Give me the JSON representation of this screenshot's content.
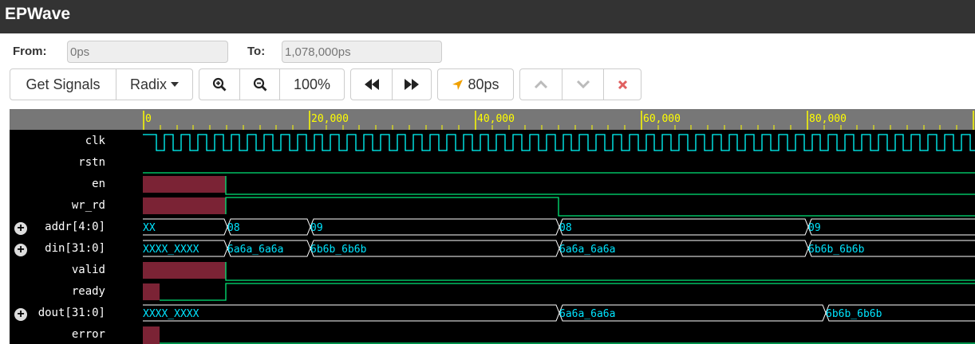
{
  "app": {
    "title": "EPWave"
  },
  "range": {
    "from_label": "From:",
    "from_value": "0ps",
    "to_label": "To:",
    "to_value": "1,078,000ps"
  },
  "toolbar": {
    "get_signals": "Get Signals",
    "radix": "Radix",
    "zoom": "100%",
    "cursor_time": "80ps"
  },
  "icons": {
    "zoom_in": "zoom-in-icon",
    "zoom_out": "zoom-out-icon",
    "prev": "rewind-icon",
    "next": "fast-forward-icon",
    "cursor": "location-arrow-icon",
    "up": "chevron-up-icon",
    "down": "chevron-down-icon",
    "close": "close-icon"
  },
  "colors": {
    "clock": "#00ffff",
    "level": "#00e676",
    "undefined": "#7b2335",
    "bus_text": "#00e5ff",
    "ruler_tick": "#ffff00"
  },
  "timeline": {
    "ticks": [
      "0",
      "20,000",
      "40,000",
      "60,000",
      "80,000"
    ]
  },
  "signals": [
    {
      "name": "clk",
      "expandable": false
    },
    {
      "name": "rstn",
      "expandable": false
    },
    {
      "name": "en",
      "expandable": false
    },
    {
      "name": "wr_rd",
      "expandable": false
    },
    {
      "name": "addr[4:0]",
      "expandable": true,
      "values": [
        "XX",
        "08",
        "09",
        "08",
        "09"
      ]
    },
    {
      "name": "din[31:0]",
      "expandable": true,
      "values": [
        "XXXX_XXXX",
        "6a6a_6a6a",
        "6b6b_6b6b",
        "6a6a_6a6a",
        "6b6b_6b6b"
      ]
    },
    {
      "name": "valid",
      "expandable": false
    },
    {
      "name": "ready",
      "expandable": false
    },
    {
      "name": "dout[31:0]",
      "expandable": true,
      "values": [
        "XXXX_XXXX",
        "6a6a_6a6a",
        "6b6b_6b6b"
      ]
    },
    {
      "name": "error",
      "expandable": false
    }
  ]
}
